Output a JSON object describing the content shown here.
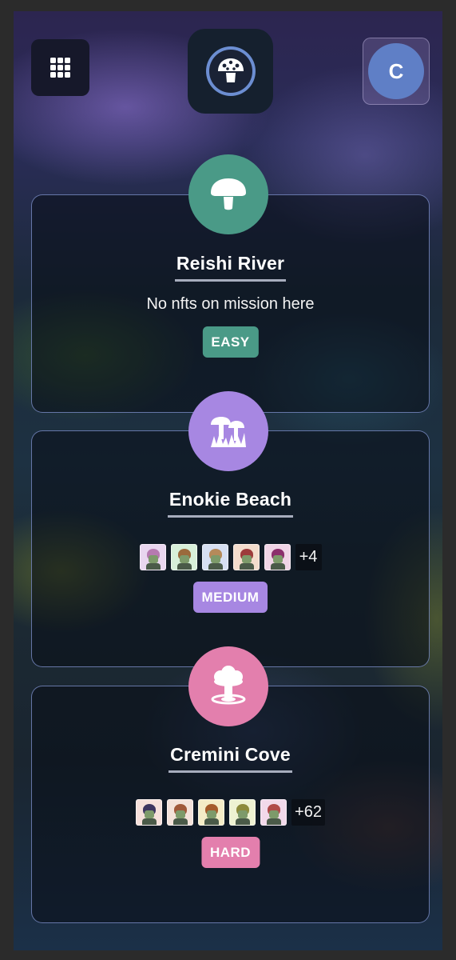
{
  "header": {
    "menu_icon": "grid-icon",
    "logo_icon": "mushroom-logo-icon",
    "avatar_initial": "C"
  },
  "colors": {
    "easy": "#4a9a87",
    "medium": "#a787e2",
    "hard": "#e37fad",
    "avatar": "#5f7fc6"
  },
  "missions": [
    {
      "name": "Reishi River",
      "icon": "mushroom-icon",
      "status": "No nfts on mission here",
      "nfts": [],
      "more": "",
      "difficulty": "EASY"
    },
    {
      "name": "Enokie Beach",
      "icon": "enoki-mushrooms-icon",
      "status": "",
      "nfts": [
        "nft-avatar",
        "nft-avatar",
        "nft-avatar",
        "nft-avatar",
        "nft-avatar"
      ],
      "more": "+4",
      "difficulty": "MEDIUM"
    },
    {
      "name": "Cremini Cove",
      "icon": "mushroom-cloud-icon",
      "status": "",
      "nfts": [
        "nft-avatar",
        "nft-avatar",
        "nft-avatar",
        "nft-avatar",
        "nft-avatar"
      ],
      "more": "+62",
      "difficulty": "HARD"
    }
  ]
}
